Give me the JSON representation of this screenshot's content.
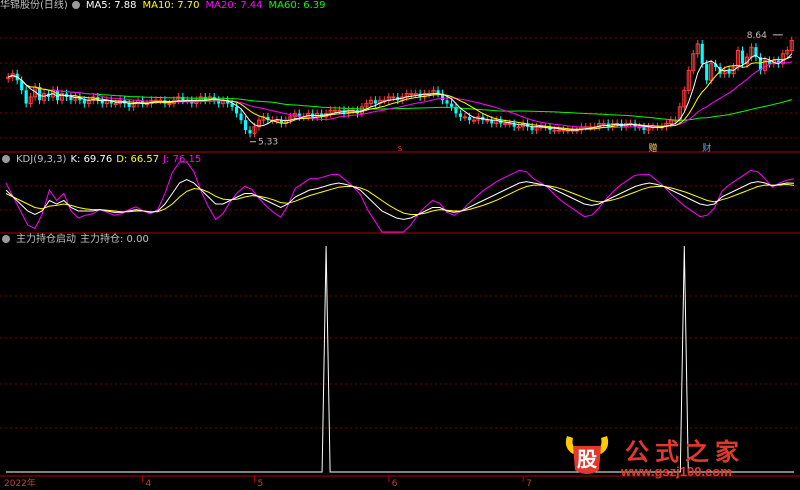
{
  "main_header": {
    "title": "华锦股份(日线)",
    "ma5": "MA5: 7.88",
    "ma10": "MA10: 7.70",
    "ma20": "MA20: 7.44",
    "ma60": "MA60: 6.39"
  },
  "kdj_header": {
    "name": "KDJ(9,3,3)",
    "k": "K: 69.76",
    "d": "D: 66.57",
    "j": "J: 76.15"
  },
  "ind_header": {
    "name": "主力持仓启动",
    "value": "主力持仓: 0.00"
  },
  "markers": {
    "s_marker": "S",
    "zeng": "赠",
    "cai": "财"
  },
  "watermark": {
    "logo_char": "股",
    "title": "公式之家",
    "url": "www.gszj100.com"
  },
  "colors": {
    "up": "#ff3c3c",
    "down": "#00ffff",
    "ma5": "#ffffff",
    "ma10": "#ffff00",
    "ma20": "#ff00ff",
    "ma60": "#00ff00",
    "k": "#ffffff",
    "d": "#ffff00",
    "j": "#ff00ff",
    "grid": "#800000"
  },
  "chart_data": [
    {
      "type": "candlestick",
      "title": "华锦股份(日线)",
      "high_label": "8.64",
      "low_label": "5.33",
      "ylim": [
        5.0,
        9.1
      ],
      "series_legend": [
        "MA5: 7.88",
        "MA10: 7.70",
        "MA20: 7.44",
        "MA60: 6.39"
      ],
      "ma_latest": {
        "MA5": 7.88,
        "MA10": 7.7,
        "MA20": 7.44,
        "MA60": 6.39
      },
      "close": [
        7.2,
        7.3,
        7.1,
        6.8,
        6.4,
        6.6,
        6.9,
        6.5,
        6.7,
        6.6,
        6.8,
        6.5,
        6.7,
        6.6,
        6.5,
        6.6,
        6.5,
        6.4,
        6.5,
        6.6,
        6.5,
        6.4,
        6.5,
        6.4,
        6.4,
        6.5,
        6.4,
        6.3,
        6.4,
        6.5,
        6.4,
        6.4,
        6.5,
        6.5,
        6.5,
        6.4,
        6.4,
        6.5,
        6.6,
        6.5,
        6.5,
        6.4,
        6.5,
        6.6,
        6.5,
        6.6,
        6.5,
        6.4,
        6.5,
        6.4,
        6.3,
        6.1,
        5.9,
        5.6,
        5.5,
        5.7,
        5.9,
        6.0,
        5.9,
        5.9,
        5.9,
        5.8,
        5.9,
        6.0,
        6.1,
        6.0,
        6.0,
        6.1,
        6.0,
        6.1,
        6.0,
        6.1,
        6.2,
        6.2,
        6.2,
        6.1,
        6.2,
        6.2,
        6.1,
        6.3,
        6.4,
        6.5,
        6.4,
        6.5,
        6.5,
        6.6,
        6.6,
        6.5,
        6.6,
        6.7,
        6.7,
        6.7,
        6.6,
        6.7,
        6.7,
        6.8,
        6.7,
        6.5,
        6.4,
        6.3,
        6.1,
        6.0,
        6.0,
        5.9,
        5.9,
        6.0,
        5.9,
        5.9,
        5.8,
        5.9,
        5.8,
        5.8,
        5.8,
        5.7,
        5.7,
        5.8,
        5.7,
        5.6,
        5.7,
        5.7,
        5.7,
        5.6,
        5.6,
        5.6,
        5.6,
        5.6,
        5.6,
        5.6,
        5.7,
        5.7,
        5.7,
        5.7,
        5.8,
        5.8,
        5.7,
        5.8,
        5.8,
        5.7,
        5.8,
        5.8,
        5.7,
        5.7,
        5.6,
        5.7,
        5.7,
        5.7,
        5.7,
        5.8,
        5.9,
        5.9,
        6.3,
        6.8,
        7.4,
        7.9,
        8.2,
        7.6,
        7.1,
        7.6,
        7.5,
        7.3,
        7.4,
        7.3,
        7.5,
        8.0,
        7.6,
        7.8,
        8.1,
        7.8,
        7.4,
        7.7,
        7.6,
        7.7,
        7.6,
        7.9,
        8.0,
        8.3
      ],
      "x_ticks": [
        "2022年",
        "4",
        "5",
        "6",
        "7"
      ],
      "annotations": [
        "S",
        "赠",
        "财"
      ]
    },
    {
      "type": "line",
      "title": "KDJ(9,3,3)",
      "ylim": [
        0,
        100
      ],
      "latest": {
        "K": 69.76,
        "D": 66.57,
        "J": 76.15
      },
      "series": [
        {
          "name": "K",
          "values": [
            60,
            50,
            40,
            30,
            25,
            30,
            45,
            40,
            45,
            35,
            30,
            30,
            30,
            32,
            30,
            28,
            28,
            30,
            32,
            30,
            28,
            30,
            40,
            55,
            70,
            75,
            70,
            60,
            50,
            40,
            40,
            45,
            50,
            55,
            55,
            50,
            45,
            40,
            35,
            40,
            50,
            55,
            60,
            62,
            65,
            68,
            70,
            68,
            65,
            60,
            50,
            40,
            30,
            25,
            20,
            18,
            20,
            25,
            30,
            35,
            35,
            30,
            28,
            30,
            35,
            40,
            45,
            50,
            55,
            60,
            65,
            70,
            72,
            70,
            68,
            65,
            60,
            55,
            50,
            45,
            40,
            38,
            40,
            45,
            50,
            55,
            60,
            65,
            68,
            70,
            68,
            65,
            60,
            55,
            50,
            45,
            40,
            38,
            40,
            50,
            55,
            60,
            65,
            70,
            72,
            70,
            66,
            68,
            70,
            69.76
          ]
        },
        {
          "name": "D",
          "values": [
            55,
            50,
            45,
            40,
            35,
            33,
            37,
            38,
            40,
            38,
            35,
            33,
            32,
            32,
            31,
            30,
            29,
            29,
            30,
            30,
            29,
            29,
            33,
            40,
            50,
            58,
            62,
            61,
            57,
            51,
            47,
            46,
            47,
            50,
            52,
            51,
            49,
            46,
            42,
            41,
            44,
            48,
            52,
            55,
            58,
            61,
            64,
            65,
            65,
            63,
            59,
            52,
            45,
            38,
            32,
            27,
            25,
            25,
            27,
            30,
            32,
            31,
            30,
            30,
            32,
            35,
            38,
            42,
            46,
            51,
            56,
            61,
            65,
            67,
            67,
            66,
            64,
            61,
            57,
            53,
            49,
            45,
            43,
            44,
            46,
            49,
            53,
            57,
            61,
            64,
            65,
            65,
            63,
            60,
            57,
            53,
            49,
            45,
            43,
            46,
            49,
            53,
            57,
            61,
            65,
            67,
            67,
            67,
            68,
            66.57
          ]
        },
        {
          "name": "J",
          "values": [
            70,
            50,
            30,
            10,
            5,
            25,
            60,
            45,
            55,
            30,
            20,
            24,
            26,
            32,
            28,
            24,
            26,
            32,
            36,
            30,
            26,
            32,
            55,
            85,
            100,
            100,
            86,
            58,
            36,
            18,
            26,
            43,
            56,
            65,
            61,
            48,
            37,
            28,
            21,
            38,
            62,
            69,
            76,
            76,
            79,
            82,
            82,
            74,
            65,
            54,
            32,
            16,
            0,
            0,
            0,
            0,
            10,
            25,
            36,
            45,
            41,
            28,
            24,
            30,
            41,
            50,
            59,
            66,
            73,
            78,
            83,
            88,
            86,
            76,
            70,
            63,
            52,
            43,
            36,
            29,
            22,
            24,
            34,
            47,
            58,
            67,
            74,
            81,
            82,
            82,
            74,
            65,
            54,
            45,
            36,
            29,
            22,
            24,
            34,
            58,
            67,
            74,
            81,
            88,
            86,
            76,
            64,
            70,
            74,
            76.15
          ]
        }
      ]
    },
    {
      "type": "line",
      "title": "主力持仓启动",
      "ylim": [
        0,
        1
      ],
      "latest": {
        "主力持仓": 0.0
      },
      "series": [
        {
          "name": "主力持仓",
          "events": [
            {
              "index": 71,
              "value": 1
            },
            {
              "index": 151,
              "value": 1
            }
          ]
        }
      ]
    }
  ]
}
